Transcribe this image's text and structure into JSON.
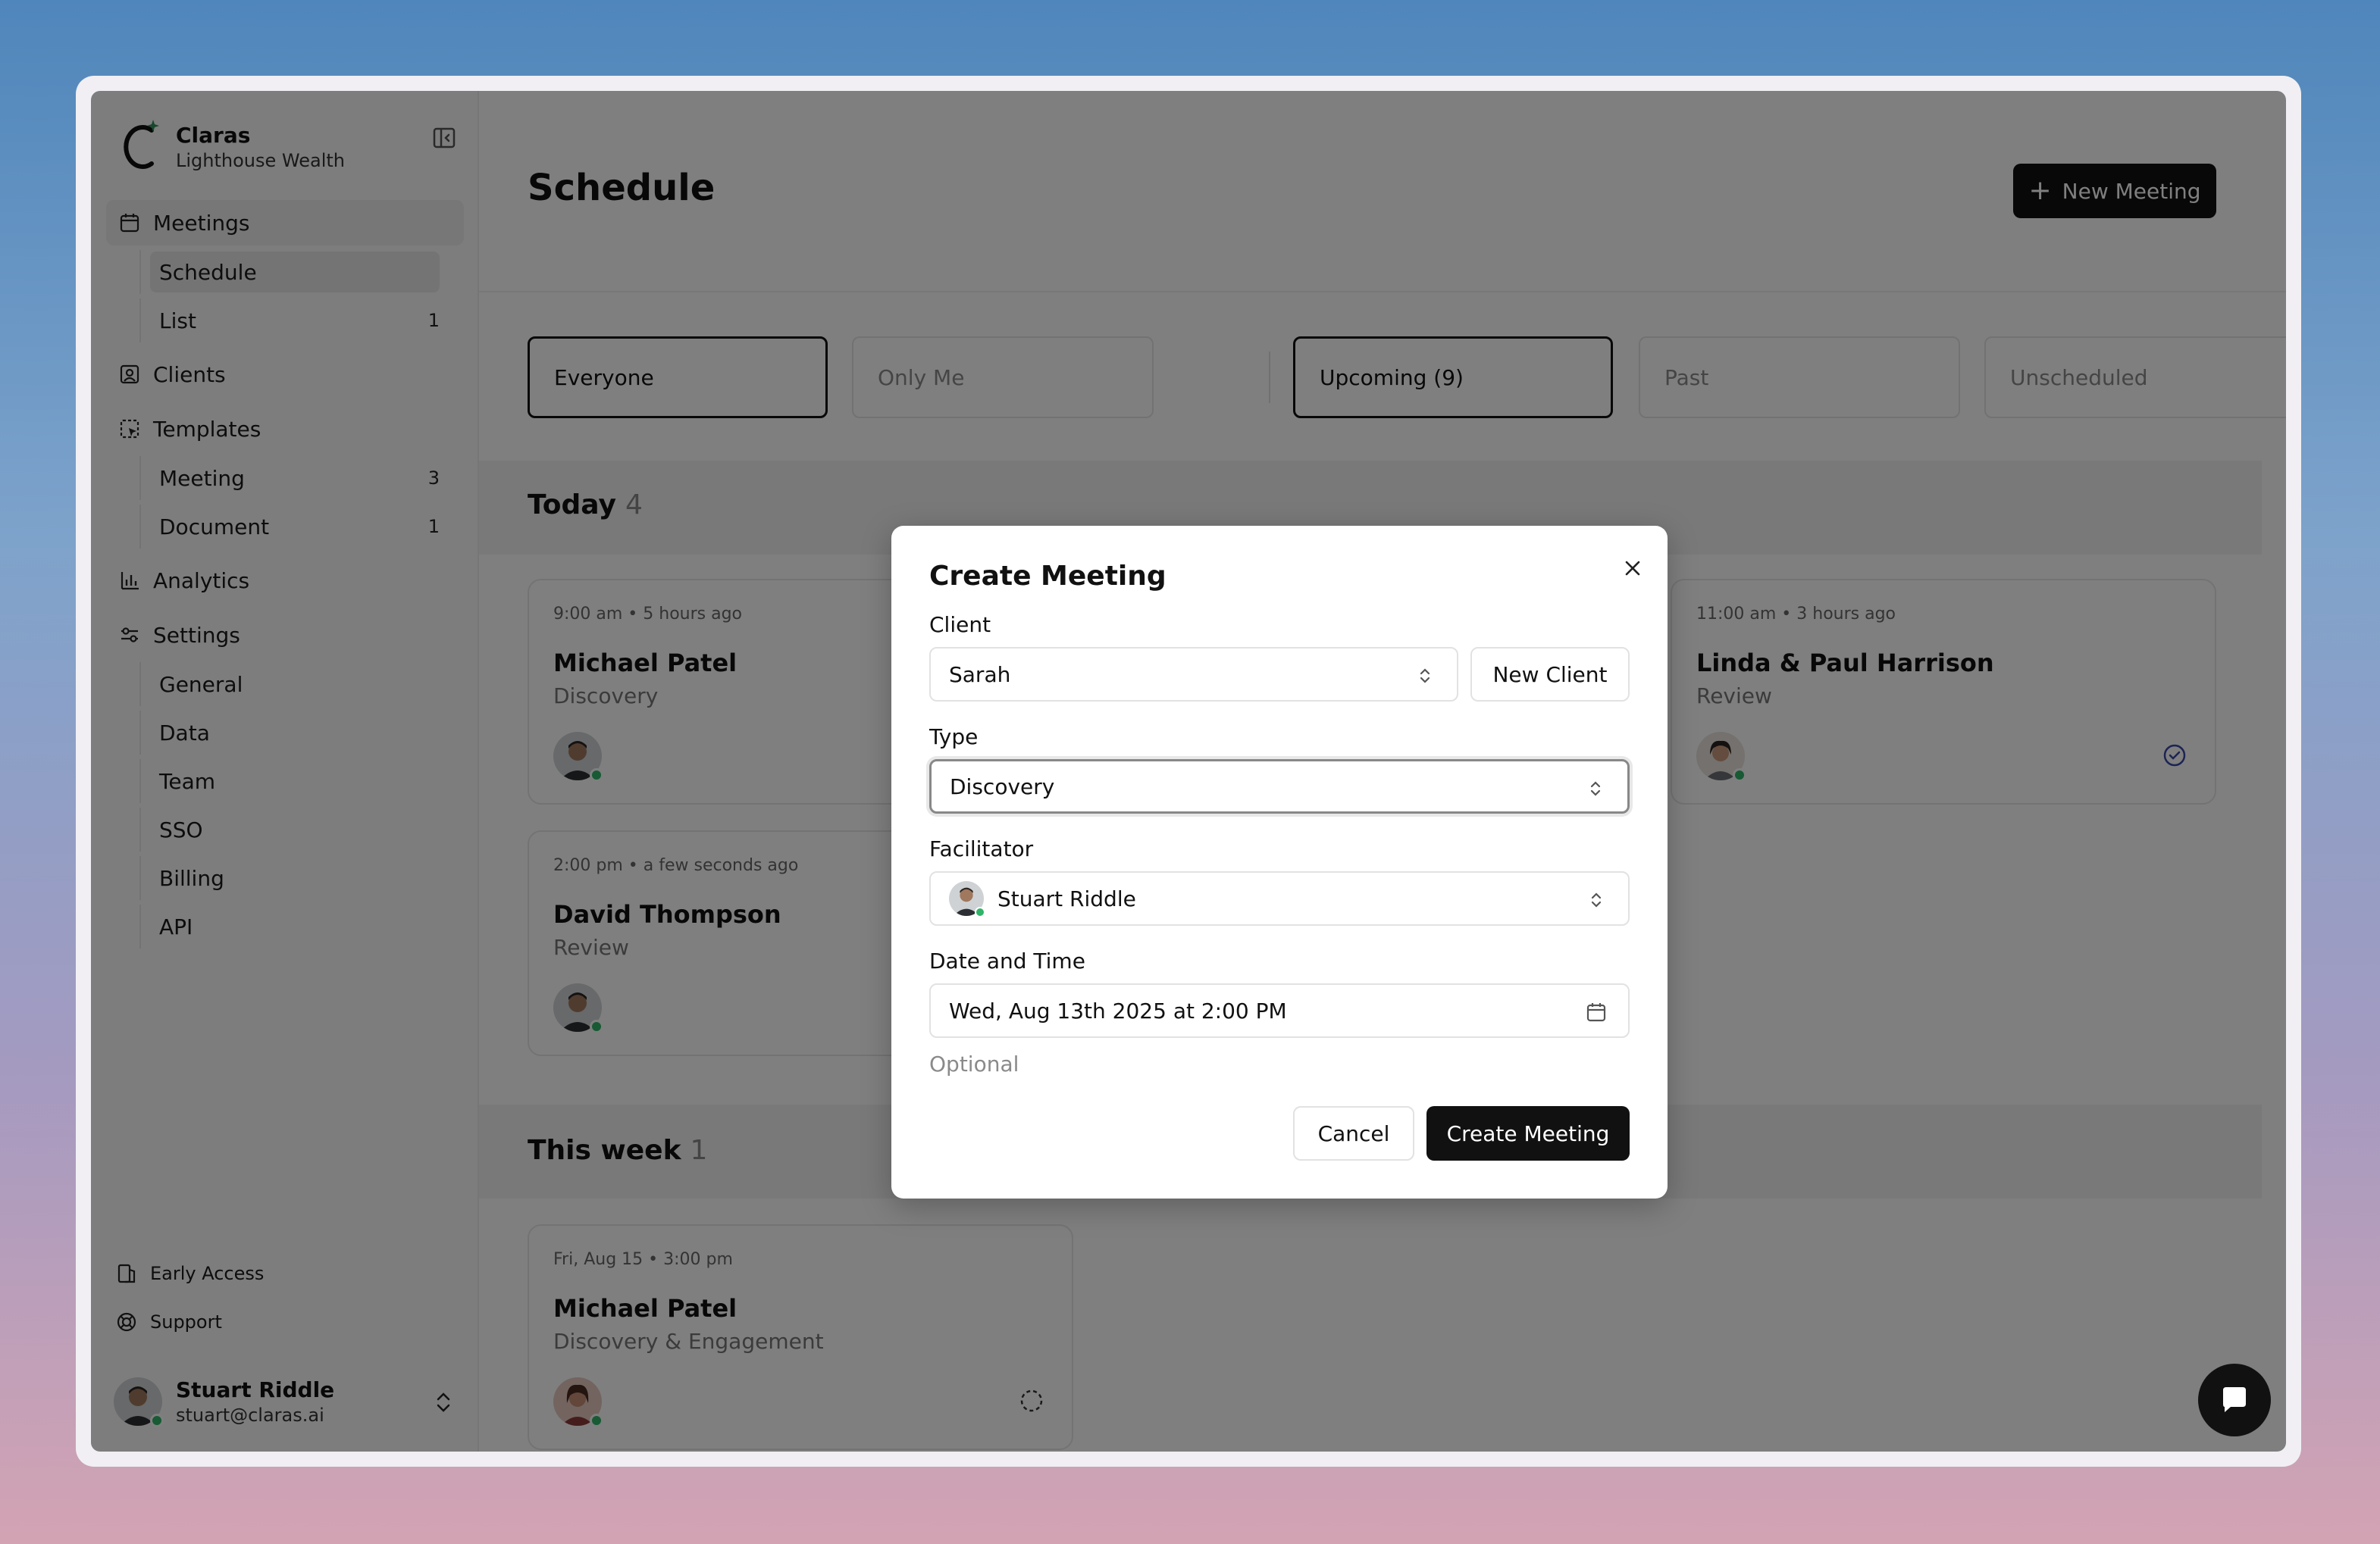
{
  "brand": {
    "name": "Claras",
    "org": "Lighthouse Wealth"
  },
  "sidebar": {
    "meetings": "Meetings",
    "schedule": "Schedule",
    "list": "List",
    "list_count": "1",
    "clients": "Clients",
    "templates": "Templates",
    "meeting_tpl": "Meeting",
    "meeting_tpl_count": "3",
    "document_tpl": "Document",
    "document_tpl_count": "1",
    "analytics": "Analytics",
    "settings": "Settings",
    "general": "General",
    "data": "Data",
    "team": "Team",
    "sso": "SSO",
    "billing": "Billing",
    "api": "API",
    "early_access": "Early Access",
    "support": "Support"
  },
  "user": {
    "name": "Stuart Riddle",
    "email": "stuart@claras.ai"
  },
  "header": {
    "title": "Schedule",
    "new_meeting": "New Meeting"
  },
  "filters": {
    "everyone": "Everyone",
    "only_me": "Only Me",
    "upcoming": "Upcoming (9)",
    "past": "Past",
    "unscheduled": "Unscheduled"
  },
  "today": {
    "title": "Today",
    "count": "4"
  },
  "this_week": {
    "title": "This week",
    "count": "1"
  },
  "cards": [
    {
      "time": "9:00 am • 5 hours ago",
      "name": "Michael Patel",
      "type": "Discovery"
    },
    {
      "time": "11:00 am • 3 hours ago",
      "name": "Linda & Paul Harrison",
      "type": "Review"
    },
    {
      "time": "2:00 pm • a few seconds ago",
      "name": "David Thompson",
      "type": "Review"
    },
    {
      "time": "Fri, Aug 15 • 3:00 pm",
      "name": "Michael Patel",
      "type": "Discovery & Engagement"
    }
  ],
  "modal": {
    "title": "Create Meeting",
    "client_label": "Client",
    "client_value": "Sarah",
    "new_client": "New Client",
    "type_label": "Type",
    "type_value": "Discovery",
    "facilitator_label": "Facilitator",
    "facilitator_value": "Stuart Riddle",
    "datetime_label": "Date and Time",
    "datetime_value": "Wed, Aug 13th 2025 at 2:00 PM",
    "optional": "Optional",
    "cancel": "Cancel",
    "create": "Create Meeting"
  },
  "colors": {
    "accent_dark": "#111111",
    "online": "#2fb468",
    "check_green": "#2f8f5b",
    "check_blue": "#3a49a8"
  }
}
